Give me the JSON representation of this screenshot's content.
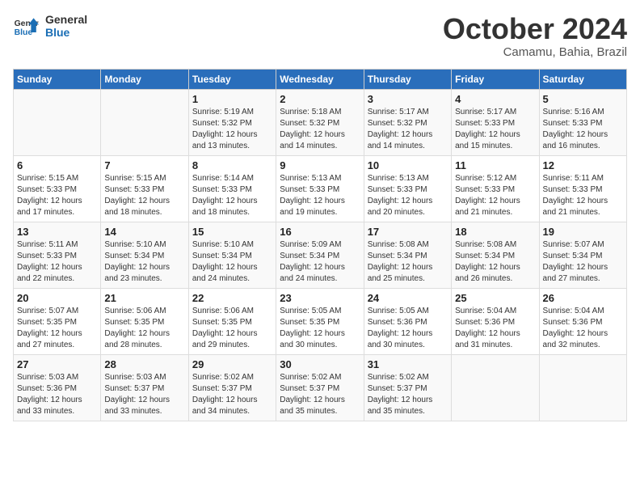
{
  "header": {
    "logo_line1": "General",
    "logo_line2": "Blue",
    "month": "October 2024",
    "location": "Camamu, Bahia, Brazil"
  },
  "days_of_week": [
    "Sunday",
    "Monday",
    "Tuesday",
    "Wednesday",
    "Thursday",
    "Friday",
    "Saturday"
  ],
  "weeks": [
    [
      {
        "day": "",
        "info": ""
      },
      {
        "day": "",
        "info": ""
      },
      {
        "day": "1",
        "info": "Sunrise: 5:19 AM\nSunset: 5:32 PM\nDaylight: 12 hours and 13 minutes."
      },
      {
        "day": "2",
        "info": "Sunrise: 5:18 AM\nSunset: 5:32 PM\nDaylight: 12 hours and 14 minutes."
      },
      {
        "day": "3",
        "info": "Sunrise: 5:17 AM\nSunset: 5:32 PM\nDaylight: 12 hours and 14 minutes."
      },
      {
        "day": "4",
        "info": "Sunrise: 5:17 AM\nSunset: 5:33 PM\nDaylight: 12 hours and 15 minutes."
      },
      {
        "day": "5",
        "info": "Sunrise: 5:16 AM\nSunset: 5:33 PM\nDaylight: 12 hours and 16 minutes."
      }
    ],
    [
      {
        "day": "6",
        "info": "Sunrise: 5:15 AM\nSunset: 5:33 PM\nDaylight: 12 hours and 17 minutes."
      },
      {
        "day": "7",
        "info": "Sunrise: 5:15 AM\nSunset: 5:33 PM\nDaylight: 12 hours and 18 minutes."
      },
      {
        "day": "8",
        "info": "Sunrise: 5:14 AM\nSunset: 5:33 PM\nDaylight: 12 hours and 18 minutes."
      },
      {
        "day": "9",
        "info": "Sunrise: 5:13 AM\nSunset: 5:33 PM\nDaylight: 12 hours and 19 minutes."
      },
      {
        "day": "10",
        "info": "Sunrise: 5:13 AM\nSunset: 5:33 PM\nDaylight: 12 hours and 20 minutes."
      },
      {
        "day": "11",
        "info": "Sunrise: 5:12 AM\nSunset: 5:33 PM\nDaylight: 12 hours and 21 minutes."
      },
      {
        "day": "12",
        "info": "Sunrise: 5:11 AM\nSunset: 5:33 PM\nDaylight: 12 hours and 21 minutes."
      }
    ],
    [
      {
        "day": "13",
        "info": "Sunrise: 5:11 AM\nSunset: 5:33 PM\nDaylight: 12 hours and 22 minutes."
      },
      {
        "day": "14",
        "info": "Sunrise: 5:10 AM\nSunset: 5:34 PM\nDaylight: 12 hours and 23 minutes."
      },
      {
        "day": "15",
        "info": "Sunrise: 5:10 AM\nSunset: 5:34 PM\nDaylight: 12 hours and 24 minutes."
      },
      {
        "day": "16",
        "info": "Sunrise: 5:09 AM\nSunset: 5:34 PM\nDaylight: 12 hours and 24 minutes."
      },
      {
        "day": "17",
        "info": "Sunrise: 5:08 AM\nSunset: 5:34 PM\nDaylight: 12 hours and 25 minutes."
      },
      {
        "day": "18",
        "info": "Sunrise: 5:08 AM\nSunset: 5:34 PM\nDaylight: 12 hours and 26 minutes."
      },
      {
        "day": "19",
        "info": "Sunrise: 5:07 AM\nSunset: 5:34 PM\nDaylight: 12 hours and 27 minutes."
      }
    ],
    [
      {
        "day": "20",
        "info": "Sunrise: 5:07 AM\nSunset: 5:35 PM\nDaylight: 12 hours and 27 minutes."
      },
      {
        "day": "21",
        "info": "Sunrise: 5:06 AM\nSunset: 5:35 PM\nDaylight: 12 hours and 28 minutes."
      },
      {
        "day": "22",
        "info": "Sunrise: 5:06 AM\nSunset: 5:35 PM\nDaylight: 12 hours and 29 minutes."
      },
      {
        "day": "23",
        "info": "Sunrise: 5:05 AM\nSunset: 5:35 PM\nDaylight: 12 hours and 30 minutes."
      },
      {
        "day": "24",
        "info": "Sunrise: 5:05 AM\nSunset: 5:36 PM\nDaylight: 12 hours and 30 minutes."
      },
      {
        "day": "25",
        "info": "Sunrise: 5:04 AM\nSunset: 5:36 PM\nDaylight: 12 hours and 31 minutes."
      },
      {
        "day": "26",
        "info": "Sunrise: 5:04 AM\nSunset: 5:36 PM\nDaylight: 12 hours and 32 minutes."
      }
    ],
    [
      {
        "day": "27",
        "info": "Sunrise: 5:03 AM\nSunset: 5:36 PM\nDaylight: 12 hours and 33 minutes."
      },
      {
        "day": "28",
        "info": "Sunrise: 5:03 AM\nSunset: 5:37 PM\nDaylight: 12 hours and 33 minutes."
      },
      {
        "day": "29",
        "info": "Sunrise: 5:02 AM\nSunset: 5:37 PM\nDaylight: 12 hours and 34 minutes."
      },
      {
        "day": "30",
        "info": "Sunrise: 5:02 AM\nSunset: 5:37 PM\nDaylight: 12 hours and 35 minutes."
      },
      {
        "day": "31",
        "info": "Sunrise: 5:02 AM\nSunset: 5:37 PM\nDaylight: 12 hours and 35 minutes."
      },
      {
        "day": "",
        "info": ""
      },
      {
        "day": "",
        "info": ""
      }
    ]
  ]
}
